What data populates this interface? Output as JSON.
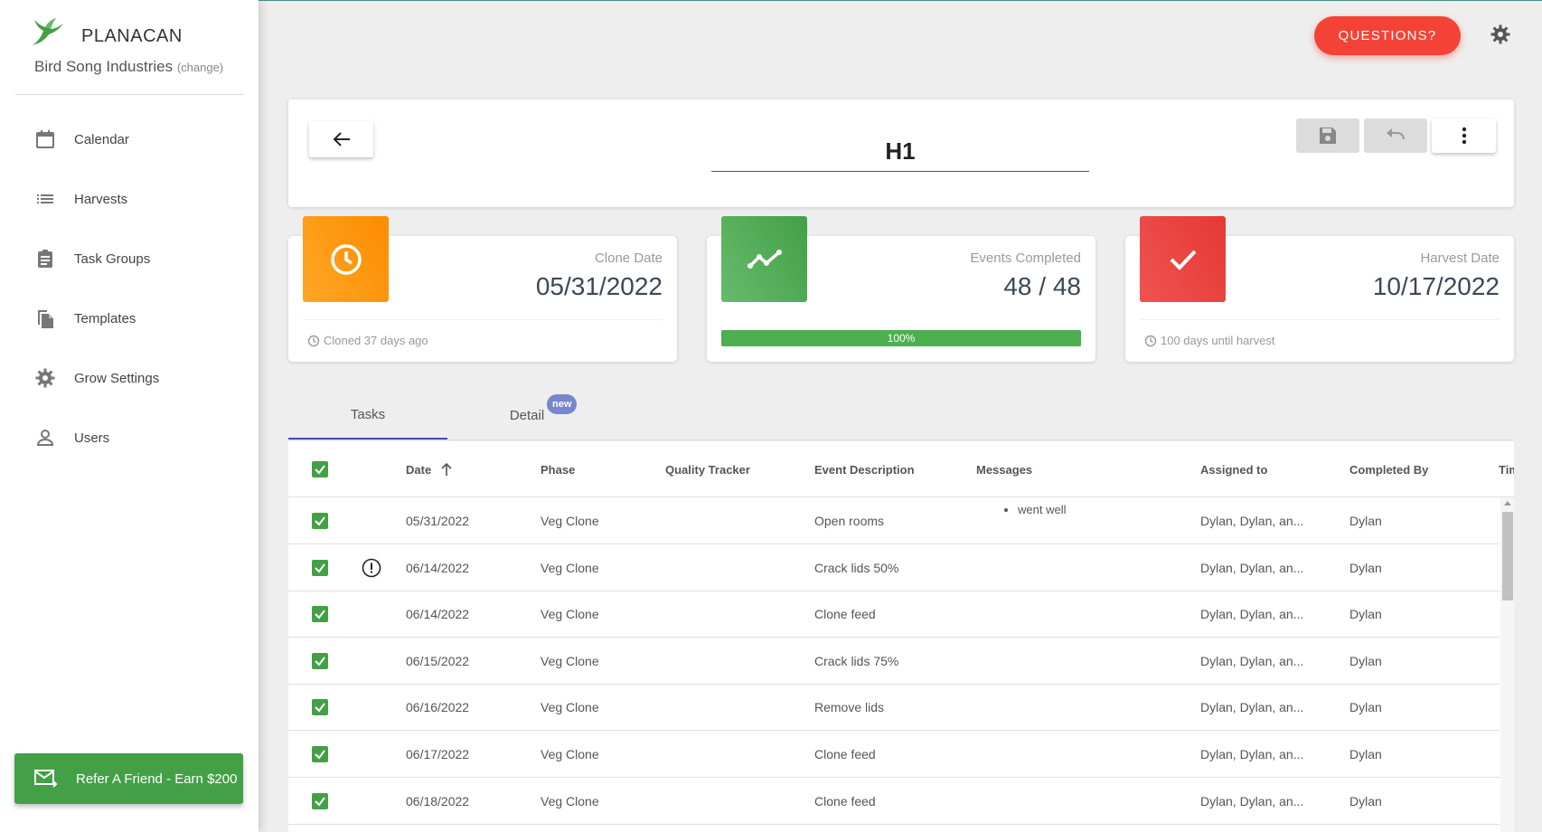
{
  "brand": {
    "name": "PLANACAN",
    "company": "Bird Song Industries",
    "change_label": "(change)"
  },
  "sidebar": {
    "items": [
      {
        "label": "Calendar",
        "icon": "calendar-icon"
      },
      {
        "label": "Harvests",
        "icon": "list-icon"
      },
      {
        "label": "Task Groups",
        "icon": "clipboard-icon"
      },
      {
        "label": "Templates",
        "icon": "file-copy-icon"
      },
      {
        "label": "Grow Settings",
        "icon": "gear-icon"
      },
      {
        "label": "Users",
        "icon": "user-icon"
      }
    ],
    "refer_label": "Refer A Friend - Earn $200"
  },
  "topbar": {
    "questions_label": "QUESTIONS?"
  },
  "header": {
    "title": "H1"
  },
  "stats": {
    "clone": {
      "label": "Clone Date",
      "value": "05/31/2022",
      "footer": "Cloned 37 days ago",
      "color": "#fb8c00"
    },
    "events": {
      "label": "Events Completed",
      "value": "48 / 48",
      "progress_label": "100%",
      "progress": 1.0,
      "color": "#43a047"
    },
    "harvest": {
      "label": "Harvest Date",
      "value": "10/17/2022",
      "footer": "100 days until harvest",
      "color": "#e53935"
    }
  },
  "tabs": {
    "tasks": "Tasks",
    "detail": "Detail",
    "new_badge": "new"
  },
  "table": {
    "headers": {
      "date": "Date",
      "phase": "Phase",
      "quality": "Quality Tracker",
      "event": "Event Description",
      "messages": "Messages",
      "assigned": "Assigned to",
      "completed": "Completed By",
      "time": "Tim"
    },
    "rows": [
      {
        "date": "05/31/2022",
        "phase": "Veg Clone",
        "event": "Open rooms",
        "message": "went well",
        "assigned": "Dylan, Dylan, an...",
        "completed": "Dylan",
        "alert": false
      },
      {
        "date": "06/14/2022",
        "phase": "Veg Clone",
        "event": "Crack lids 50%",
        "message": "",
        "assigned": "Dylan, Dylan, an...",
        "completed": "Dylan",
        "alert": true
      },
      {
        "date": "06/14/2022",
        "phase": "Veg Clone",
        "event": "Clone feed",
        "message": "",
        "assigned": "Dylan, Dylan, an...",
        "completed": "Dylan",
        "alert": false
      },
      {
        "date": "06/15/2022",
        "phase": "Veg Clone",
        "event": "Crack lids 75%",
        "message": "",
        "assigned": "Dylan, Dylan, an...",
        "completed": "Dylan",
        "alert": false
      },
      {
        "date": "06/16/2022",
        "phase": "Veg Clone",
        "event": "Remove lids",
        "message": "",
        "assigned": "Dylan, Dylan, an...",
        "completed": "Dylan",
        "alert": false
      },
      {
        "date": "06/17/2022",
        "phase": "Veg Clone",
        "event": "Clone feed",
        "message": "",
        "assigned": "Dylan, Dylan, an...",
        "completed": "Dylan",
        "alert": false
      },
      {
        "date": "06/18/2022",
        "phase": "Veg Clone",
        "event": "Clone feed",
        "message": "",
        "assigned": "Dylan, Dylan, an...",
        "completed": "Dylan",
        "alert": false
      }
    ]
  }
}
